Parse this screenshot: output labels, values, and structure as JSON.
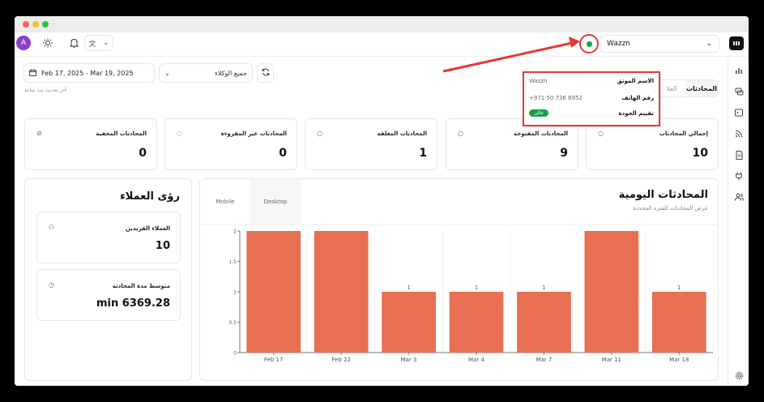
{
  "window": {
    "dots": [
      "#ff5f57",
      "#febc2e",
      "#28c840"
    ]
  },
  "topbar": {
    "avatar_letter": "A",
    "inbox_name": "Wazzn",
    "chevron": "⌄"
  },
  "nav": {
    "icons": [
      "bar-chart-icon",
      "chat-icon",
      "terminal-icon",
      "rss-icon",
      "document-icon",
      "plug-icon",
      "users-icon",
      "gear-icon"
    ]
  },
  "filters": {
    "date_range": "Feb 17, 2025 - Mar 19, 2025",
    "agents": "جميع الوكلاء",
    "last_update": "آخر تحديث منذ ساعة"
  },
  "tabs": [
    {
      "label": "المحادثات",
      "active": true
    },
    {
      "label": "العلا",
      "active": false
    }
  ],
  "popup": {
    "rows": [
      {
        "key": "الاسم الموثق",
        "value": "Wazzn"
      },
      {
        "key": "رقم الهاتف",
        "value": "+971 50 736 6952"
      },
      {
        "key": "تقييم الجودة",
        "value": "عالي"
      }
    ],
    "badge_color": "#16a34a"
  },
  "stats": [
    {
      "label": "إجمالي المحادثات",
      "value": "10"
    },
    {
      "label": "المحادثات المفتوحة",
      "value": "9"
    },
    {
      "label": "المحادثات المغلقة",
      "value": "1"
    },
    {
      "label": "المحادثات غير المقروءة",
      "value": "0"
    },
    {
      "label": "المحادثات المخفية",
      "value": "0"
    }
  ],
  "insights": {
    "title": "رؤى العملاء",
    "unique_label": "العملاء الفريدين",
    "unique_value": "10",
    "avg_label": "متوسط مدة المحادثة",
    "avg_value": "min 6369.28"
  },
  "daily": {
    "title": "المحادثات اليومية",
    "subtitle": "عرض المحادثات للفترة المحددة",
    "tabs": [
      "Mobile",
      "Desktop"
    ]
  },
  "chart_data": {
    "type": "bar",
    "title": "المحادثات اليومية",
    "categories": [
      "Feb 17",
      "Feb 22",
      "Mar 3",
      "Mar 4",
      "Mar 7",
      "Mar 11",
      "Mar 18"
    ],
    "values": [
      2,
      2,
      1,
      1,
      1,
      2,
      1
    ],
    "data_labels": [
      "",
      "",
      "1",
      "1",
      "1",
      "",
      "1"
    ],
    "yticks": [
      "0",
      "0.5",
      "1",
      "1.5",
      "2"
    ],
    "ylim": [
      0,
      2
    ],
    "bar_color": "#e96f53",
    "grid": true
  }
}
